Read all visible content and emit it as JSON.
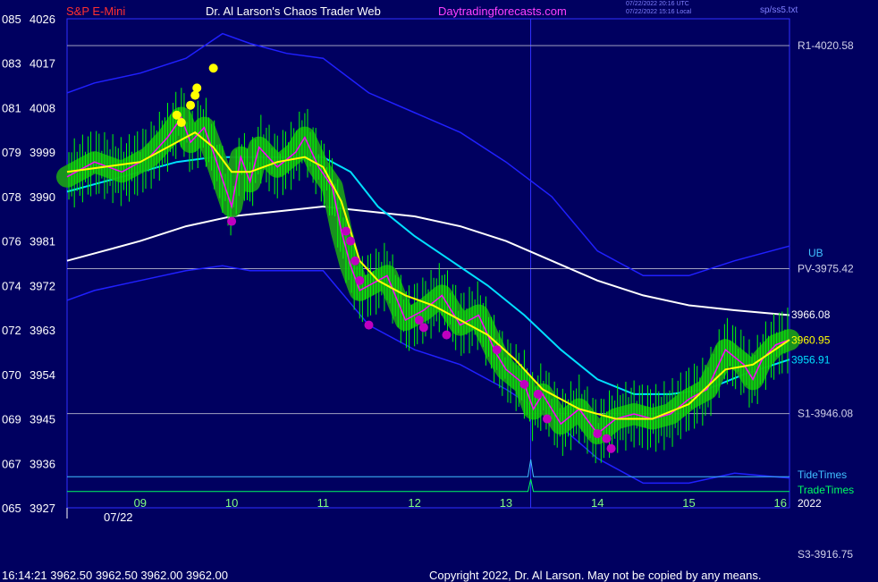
{
  "header": {
    "symbol": "S&P E-Mini",
    "title": "Dr. Al Larson's Chaos Trader Web",
    "site": "Daytradingforecasts.com",
    "utc_time": "07/22/2022 20:16 UTC",
    "local_time": "07/22/2022 15:16 Local",
    "file": "sp/ss5.txt"
  },
  "footer": {
    "quote": "16:14:21  3962.50 3962.50 3962.00 3962.00",
    "copyright": "Copyright 2022, Dr. Al Larson. May not be copied by any means."
  },
  "colors": {
    "background": "#000060",
    "frame": "#3030ff",
    "price": "#ff00ff",
    "fast_ma": "#ffff00",
    "mid_ma": "#00e0ff",
    "slow_ma": "#ffffff",
    "envelope": "#2020ff",
    "bar_halo": "#1a9a1a",
    "bars": "#00ff00",
    "highs_dots": "#ffff00",
    "lows_dots": "#c000c0",
    "tide": "#40c0ff",
    "trade": "#00ff60"
  },
  "chart_data": {
    "type": "line",
    "x_unit": "hour",
    "date_label": "07/22",
    "year_label": "2022",
    "xlim": [
      8.2,
      16.1
    ],
    "ylim": [
      3927,
      4026
    ],
    "x_ticks": [
      9,
      10,
      11,
      12,
      13,
      14,
      15,
      16
    ],
    "y_ticks": [
      {
        "left": "065",
        "right": "3927"
      },
      {
        "left": "067",
        "right": "3936"
      },
      {
        "left": "069",
        "right": "3945"
      },
      {
        "left": "070",
        "right": "3954"
      },
      {
        "left": "072",
        "right": "3963"
      },
      {
        "left": "074",
        "right": "3972"
      },
      {
        "left": "076",
        "right": "3981"
      },
      {
        "left": "078",
        "right": "3990"
      },
      {
        "left": "079",
        "right": "3999"
      },
      {
        "left": "081",
        "right": "4008"
      },
      {
        "left": "083",
        "right": "4017"
      },
      {
        "left": "085",
        "right": "4026"
      }
    ],
    "levels": [
      {
        "name": "R1",
        "label": "R1-4020.58",
        "value": 4020.58
      },
      {
        "name": "PV",
        "label": "PV-3975.42",
        "value": 3975.42
      },
      {
        "name": "S1",
        "label": "S1-3946.08",
        "value": 3946.08
      },
      {
        "name": "S3",
        "label": "S3-3916.75",
        "value": 3916.75
      }
    ],
    "side_labels": {
      "ub": "UB",
      "tide": "TideTimes",
      "trade": "TradeTimes"
    },
    "series": [
      {
        "name": "price",
        "x": [
          8.2,
          8.5,
          8.8,
          9.1,
          9.3,
          9.45,
          9.55,
          9.7,
          9.8,
          10.0,
          10.1,
          10.2,
          10.3,
          10.5,
          10.7,
          10.8,
          10.95,
          11.1,
          11.2,
          11.3,
          11.4,
          11.5,
          11.7,
          11.9,
          12.1,
          12.3,
          12.5,
          12.7,
          12.9,
          13.0,
          13.2,
          13.3,
          13.4,
          13.6,
          13.8,
          14.0,
          14.2,
          14.4,
          14.6,
          14.8,
          15.0,
          15.2,
          15.4,
          15.6,
          15.7,
          15.8,
          15.95,
          16.1
        ],
        "y": [
          3994,
          3997,
          3995,
          3998,
          4002,
          4006,
          4001,
          4004,
          3999,
          3988,
          3998,
          3993,
          4000,
          3996,
          3999,
          4002,
          3996,
          3992,
          3983,
          3976,
          3971,
          3972,
          3974,
          3965,
          3967,
          3970,
          3964,
          3966,
          3958,
          3955,
          3952,
          3947,
          3950,
          3944,
          3947,
          3942,
          3945,
          3946,
          3945,
          3946,
          3949,
          3951,
          3959,
          3956,
          3953,
          3957,
          3960,
          3961
        ]
      },
      {
        "name": "fast",
        "x": [
          8.2,
          8.6,
          9.0,
          9.4,
          9.6,
          9.8,
          10.0,
          10.2,
          10.5,
          10.8,
          11.0,
          11.2,
          11.4,
          11.6,
          11.9,
          12.2,
          12.5,
          12.8,
          13.1,
          13.4,
          13.8,
          14.2,
          14.6,
          15.0,
          15.4,
          15.7,
          16.1
        ],
        "y": [
          3995,
          3996,
          3997,
          4001,
          4003,
          4000,
          3995,
          3995,
          3997,
          3998,
          3996,
          3989,
          3977,
          3973,
          3970,
          3968,
          3965,
          3962,
          3957,
          3951,
          3947,
          3945,
          3945,
          3948,
          3955,
          3956,
          3961
        ]
      },
      {
        "name": "mid",
        "x": [
          8.2,
          8.6,
          9.0,
          9.4,
          9.8,
          10.2,
          10.6,
          11.0,
          11.3,
          11.6,
          12.0,
          12.4,
          12.8,
          13.2,
          13.6,
          14.0,
          14.4,
          14.8,
          15.2,
          15.6,
          16.1
        ],
        "y": [
          3991,
          3993,
          3995,
          3997,
          3998,
          3998,
          3998,
          3998,
          3995,
          3988,
          3982,
          3977,
          3972,
          3966,
          3959,
          3953,
          3950,
          3950,
          3951,
          3954,
          3957
        ]
      },
      {
        "name": "slow",
        "x": [
          8.2,
          8.6,
          9.0,
          9.5,
          10.0,
          10.5,
          11.0,
          11.5,
          12.0,
          12.5,
          13.0,
          13.5,
          14.0,
          14.5,
          15.0,
          15.5,
          16.1
        ],
        "y": [
          3977,
          3979,
          3981,
          3984,
          3986,
          3987,
          3988,
          3987,
          3986,
          3984,
          3981,
          3977,
          3973,
          3970,
          3968,
          3967,
          3966
        ]
      },
      {
        "name": "upper_band",
        "x": [
          8.2,
          8.5,
          9.0,
          9.5,
          9.9,
          10.2,
          10.6,
          11.0,
          11.5,
          12.0,
          12.5,
          13.0,
          13.5,
          14.0,
          14.5,
          15.0,
          15.5,
          16.1
        ],
        "y": [
          4011,
          4013,
          4015,
          4018,
          4023,
          4021,
          4019,
          4018,
          4011,
          4007,
          4003,
          3997,
          3990,
          3979,
          3974,
          3974,
          3977,
          3980
        ]
      },
      {
        "name": "lower_band",
        "x": [
          8.2,
          8.5,
          9.0,
          9.5,
          9.9,
          10.2,
          10.6,
          11.0,
          11.5,
          12.0,
          12.5,
          13.0,
          13.5,
          14.0,
          14.5,
          15.0,
          15.5,
          16.1
        ],
        "y": [
          3969,
          3971,
          3973,
          3975,
          3976,
          3975,
          3975,
          3975,
          3964,
          3959,
          3956,
          3951,
          3945,
          3937,
          3932,
          3932,
          3934,
          3933
        ]
      },
      {
        "name": "tide_line",
        "x": [
          8.2,
          13.24,
          13.27,
          13.3,
          16.1
        ],
        "y": [
          3933.3,
          3933.3,
          3936.8,
          3933.3,
          3933.3
        ]
      },
      {
        "name": "trade_line",
        "x": [
          8.2,
          13.24,
          13.27,
          13.3,
          16.1
        ],
        "y": [
          3930.3,
          3930.3,
          3932.8,
          3930.3,
          3930.3
        ]
      }
    ],
    "high_dots": [
      [
        9.4,
        4006.5
      ],
      [
        9.45,
        4005
      ],
      [
        9.55,
        4008.5
      ],
      [
        9.6,
        4010.5
      ],
      [
        9.62,
        4012
      ],
      [
        9.8,
        4016
      ]
    ],
    "low_dots": [
      [
        10.0,
        3985
      ],
      [
        11.25,
        3983
      ],
      [
        11.3,
        3981
      ],
      [
        11.35,
        3977
      ],
      [
        11.4,
        3973
      ],
      [
        11.5,
        3964
      ],
      [
        12.05,
        3965
      ],
      [
        12.1,
        3963.5
      ],
      [
        12.35,
        3962
      ],
      [
        12.9,
        3959
      ],
      [
        13.2,
        3952
      ],
      [
        13.35,
        3950
      ],
      [
        13.45,
        3945
      ],
      [
        14.0,
        3942
      ],
      [
        14.1,
        3941
      ],
      [
        14.15,
        3939
      ]
    ],
    "end_labels": [
      {
        "series": "slow",
        "label": "3966.08",
        "value": 3966.08
      },
      {
        "series": "fast",
        "label": "3960.95",
        "value": 3960.95
      },
      {
        "series": "mid",
        "label": "3956.91",
        "value": 3956.91
      }
    ]
  }
}
